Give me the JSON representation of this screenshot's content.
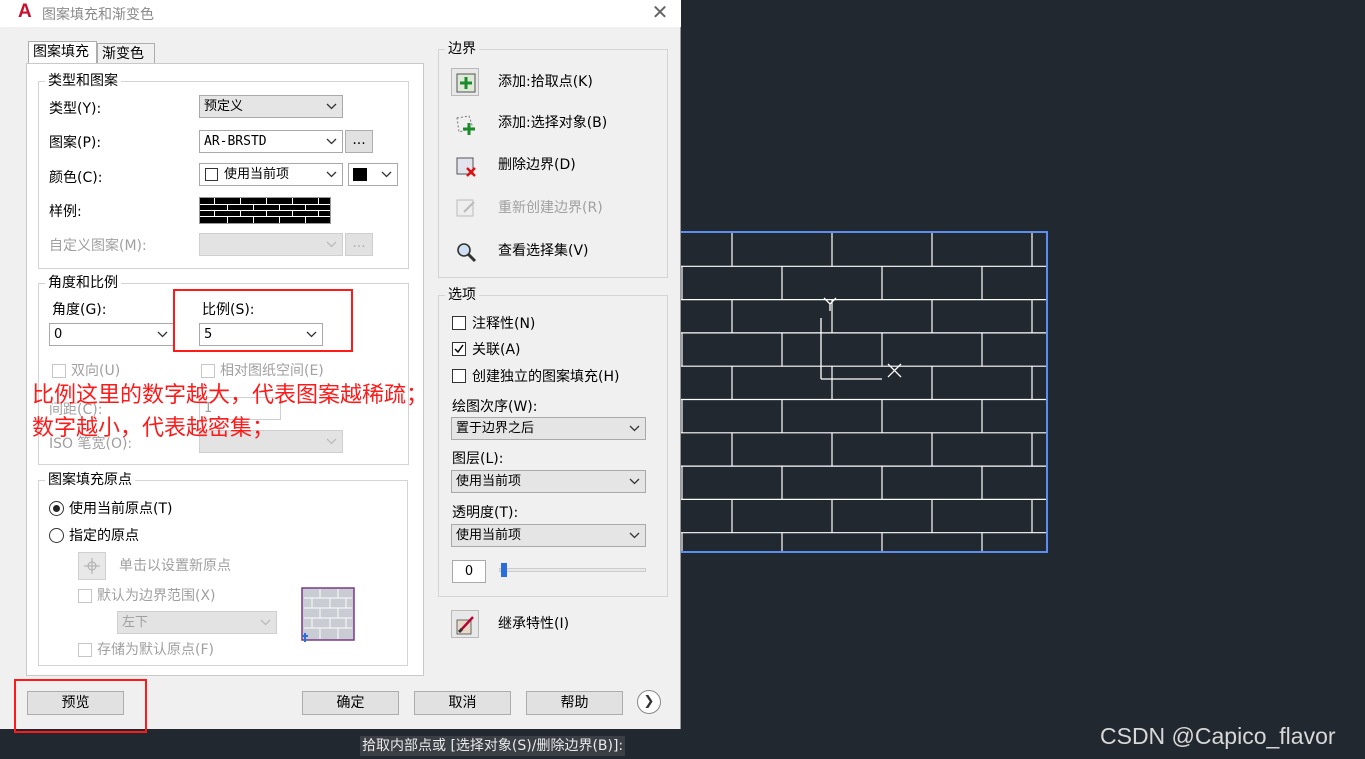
{
  "window": {
    "title": "图案填充和渐变色",
    "close_glyph": "✕",
    "app_glyph": "A"
  },
  "tabs": [
    {
      "label": "图案填充"
    },
    {
      "label": "渐变色"
    }
  ],
  "type_pattern": {
    "title": "类型和图案",
    "type_label": "类型(Y):",
    "type_value": "预定义",
    "pattern_label": "图案(P):",
    "pattern_value": "AR-BRSTD",
    "ellipsis": "...",
    "color_label": "颜色(C):",
    "color_value": "使用当前项",
    "swatch_label": "样例:",
    "custom_label": "自定义图案(M):"
  },
  "angle_scale": {
    "title": "角度和比例",
    "angle_label": "角度(G):",
    "angle_value": "0",
    "scale_label": "比例(S):",
    "scale_value": "5",
    "double_label": "双向(U)",
    "relative_label": "相对图纸空间(E)",
    "spacing_label": "间距(C):",
    "spacing_value": "1",
    "iso_label": "ISO 笔宽(O):"
  },
  "origin": {
    "title": "图案填充原点",
    "use_current_label": "使用当前原点(T)",
    "specified_label": "指定的原点",
    "click_set_label": "单击以设置新原点",
    "default_extent_label": "默认为边界范围(X)",
    "position_value": "左下",
    "store_default_label": "存储为默认原点(F)"
  },
  "boundaries": {
    "title": "边界",
    "add_pick_label": "添加:拾取点(K)",
    "add_select_label": "添加:选择对象(B)",
    "remove_label": "删除边界(D)",
    "recreate_label": "重新创建边界(R)",
    "view_label": "查看选择集(V)"
  },
  "options": {
    "title": "选项",
    "annotative_label": "注释性(N)",
    "associative_label": "关联(A)",
    "separate_label": "创建独立的图案填充(H)",
    "draw_order_label": "绘图次序(W):",
    "draw_order_value": "置于边界之后",
    "layer_label": "图层(L):",
    "layer_value": "使用当前项",
    "transparency_label": "透明度(T):",
    "transparency_combo_value": "使用当前项",
    "transparency_value": "0"
  },
  "inherit_label": "继承特性(I)",
  "footer": {
    "preview_label": "预览",
    "ok_label": "确定",
    "cancel_label": "取消",
    "help_label": "帮助",
    "more_glyph": "❯"
  },
  "annotation": {
    "line1": "比例这里的数字越大，代表图案越稀疏；",
    "line2": "数字越小，代表越密集；"
  },
  "command_line": "拾取内部点或 [选择对象(S)/删除边界(B)]:",
  "watermark": "CSDN @Capico_flavor",
  "colors": {
    "canvas_bg": "#212830",
    "hatch_line": "#ffffff",
    "boundary": "#5b8ef0",
    "annotation_red": "#ff1a1a"
  }
}
